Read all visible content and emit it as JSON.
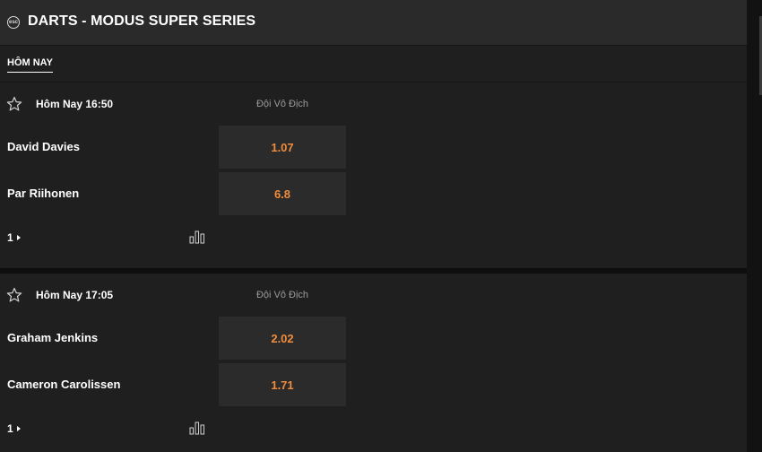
{
  "header": {
    "logo_icon": "sport-logo-icon",
    "logo_text": "esc",
    "title": "DARTS - MODUS SUPER SERIES"
  },
  "tabs": [
    {
      "label": "HÔM NAY",
      "active": true
    }
  ],
  "matches": [
    {
      "time": "Hôm Nay 16:50",
      "market": "Đội Vô Địch",
      "players": [
        {
          "name": "David Davies",
          "odds": "1.07"
        },
        {
          "name": "Par Riihonen",
          "odds": "6.8"
        }
      ],
      "more_markets": "1"
    },
    {
      "time": "Hôm Nay 17:05",
      "market": "Đội Vô Địch",
      "players": [
        {
          "name": "Graham Jenkins",
          "odds": "2.02"
        },
        {
          "name": "Cameron Carolissen",
          "odds": "1.71"
        }
      ],
      "more_markets": "1"
    }
  ],
  "colors": {
    "background": "#1f1f1f",
    "header_bg": "#2a2a2a",
    "odds_bg": "#2b2b2b",
    "odds_text": "#f08c3c",
    "muted_text": "#9a9a9a"
  }
}
